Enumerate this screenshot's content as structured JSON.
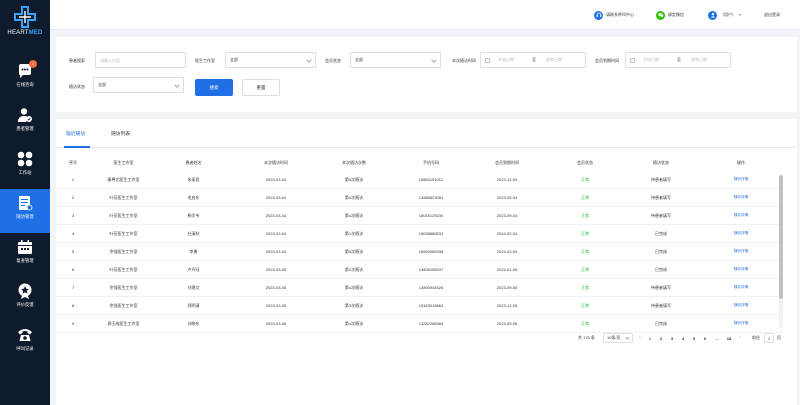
{
  "brand": {
    "logo_text_1": "HEART",
    "logo_text_2": "MED",
    "accent": "#1f6fe5",
    "sidebar_bg": "#0e1b2c"
  },
  "sidebar": {
    "items": [
      {
        "label": "在线咨询",
        "icon": "chat-bubble-icon",
        "badge": "1"
      },
      {
        "label": "患者管理",
        "icon": "patient-icon"
      },
      {
        "label": "工作站",
        "icon": "grid-dots-icon"
      },
      {
        "label": "随访管理",
        "icon": "followup-icon",
        "active": true
      },
      {
        "label": "复查管理",
        "icon": "calendar-icon"
      },
      {
        "label": "评价反馈",
        "icon": "star-badge-icon"
      },
      {
        "label": "呼叫记录",
        "icon": "phone-icon"
      }
    ]
  },
  "topbar": {
    "service": "请联系呼叫中心",
    "wechat": "绑定微信",
    "user": "（用户）",
    "logout": "退出登录"
  },
  "filters": {
    "patient_search_label": "患者搜索",
    "patient_search_placeholder": "请输入内容",
    "studio_label": "医生工作室",
    "studio_value": "全部",
    "member_status_label": "会员状态",
    "member_status_value": "全部",
    "next_followup_label": "本次随访时间",
    "expire_label": "会员到期时间",
    "start_placeholder": "开始日期",
    "end_placeholder": "结束日期",
    "range_sep": "至",
    "followup_status_label": "随访状态",
    "followup_status_value": "全部",
    "search_button": "搜索",
    "reset_button": "重置"
  },
  "tabs": [
    {
      "label": "临近随访",
      "active": true
    },
    {
      "label": "随访列表",
      "active": false
    }
  ],
  "table": {
    "columns": [
      "序号",
      "医生工作室",
      "患者姓名",
      "本次随访时间",
      "本次随访次数",
      "手机号码",
      "会员到期时间",
      "会员状态",
      "随访状态",
      "操作"
    ],
    "rows": [
      [
        "1",
        "秦粤北医生工作室",
        "朱丽君",
        "2023-03-04",
        "第5次随访",
        "15883151012",
        "2023-12-04",
        "正常",
        "待患者填写",
        "随访详情"
      ],
      [
        "2",
        "叶莅医生工作室",
        "毛启东",
        "2023-03-04",
        "第4次随访",
        "13986823081",
        "2023-09-04",
        "正常",
        "待患者填写",
        "随访详情"
      ],
      [
        "3",
        "叶莅医生工作室",
        "杨学韦",
        "2023-03-04",
        "第4次随访",
        "18015129230",
        "2023-09-04",
        "正常",
        "待患者填写",
        "随访详情"
      ],
      [
        "4",
        "叶莅医生工作室",
        "杜清秋",
        "2023-03-04",
        "第1次随访",
        "15038685531",
        "2024-02-04",
        "正常",
        "已完成",
        "随访详情"
      ],
      [
        "5",
        "余强医生工作室",
        "李勇",
        "2023-03-04",
        "第5次随访",
        "18909085338",
        "2024-03-04",
        "正常",
        "已完成",
        "随访详情"
      ],
      [
        "6",
        "叶莅医生工作室",
        "卢丹珏",
        "2023-03-05",
        "第2次随访",
        "13808156537",
        "2024-01-05",
        "正常",
        "已完成",
        "随访详情"
      ],
      [
        "7",
        "余强医生工作室",
        "刘建文",
        "2023-03-05",
        "第4次随访",
        "13890944528",
        "2023-09-05",
        "正常",
        "待患者填写",
        "随访详情"
      ],
      [
        "8",
        "余强医生工作室",
        "郑明清",
        "2023-03-05",
        "第3次随访",
        "15183018863",
        "2023-12-05",
        "正常",
        "待患者填写",
        "随访详情"
      ],
      [
        "9",
        "郭玉成医生工作室",
        "孙晓东",
        "2023-03-06",
        "第4次随访",
        "13282266984",
        "2023-09-06",
        "正常",
        "已完成",
        "随访详情"
      ]
    ],
    "status_ok_color": "#21b534"
  },
  "pagination": {
    "total": "共 176 条",
    "page_size": "10条/页",
    "pages": [
      "1",
      "2",
      "3",
      "4",
      "5",
      "6",
      "...",
      "18"
    ],
    "current": "1",
    "goto_label": "前往",
    "goto_value": "1",
    "page_suffix": "页"
  }
}
